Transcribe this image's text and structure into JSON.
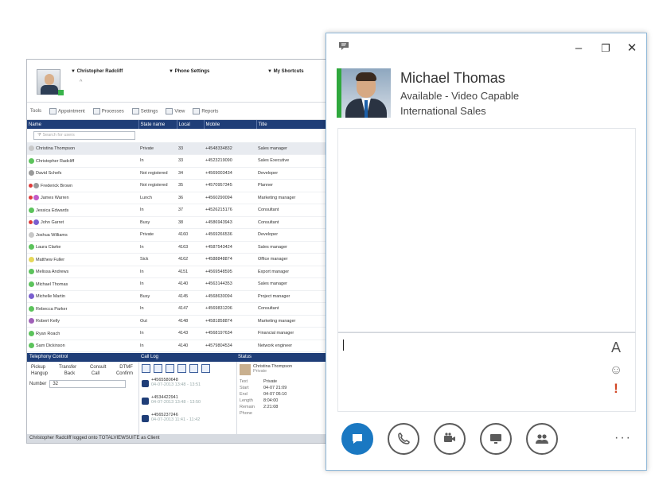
{
  "bg_window": {
    "user_menu": "Christopher Radcliff",
    "phone_menu": "Phone Settings",
    "shortcuts_menu": "My Shortcuts",
    "toolbar": [
      "Tools",
      "Appointment",
      "Processes",
      "Settings",
      "View",
      "Reports"
    ],
    "columns": [
      "Name",
      "State name",
      "Local",
      "Mobile",
      "Title"
    ],
    "search_placeholder": "Search for users",
    "contacts": [
      {
        "name": "Christina Thompson",
        "state": "Private",
        "local": "33",
        "mobile": "+4548334832",
        "title": "Sales manager",
        "dot": "#c8c8c8",
        "cc": false
      },
      {
        "name": "Christopher Radcliff",
        "state": "In",
        "local": "33",
        "mobile": "+4523219090",
        "title": "Sales Executive",
        "dot": "#5cc35c",
        "cc": false
      },
      {
        "name": "David Schefs",
        "state": "Not registered",
        "local": "34",
        "mobile": "+4569003434",
        "title": "Developer",
        "dot": "#9a9a9a",
        "cc": false
      },
      {
        "name": "Frederick Brown",
        "state": "Not registered",
        "local": "35",
        "mobile": "+4570957345",
        "title": "Planner",
        "dot": "#9a9a9a",
        "cc": true
      },
      {
        "name": "James Warren",
        "state": "Lunch",
        "local": "36",
        "mobile": "+4560290094",
        "title": "Marketing manager",
        "dot": "#c15cc8",
        "cc": true
      },
      {
        "name": "Jessica Edwards",
        "state": "In",
        "local": "37",
        "mobile": "+4526215176",
        "title": "Consultant",
        "dot": "#5cc35c",
        "cc": false
      },
      {
        "name": "John Garret",
        "state": "Busy",
        "local": "38",
        "mobile": "+4586943943",
        "title": "Consultant",
        "dot": "#7a5fcf",
        "cc": true
      },
      {
        "name": "Joshua Williams",
        "state": "Private",
        "local": "4160",
        "mobile": "+4569266536",
        "title": "Developer",
        "dot": "#c8c8c8",
        "cc": false
      },
      {
        "name": "Laura Clarke",
        "state": "In",
        "local": "4163",
        "mobile": "+4587543424",
        "title": "Sales manager",
        "dot": "#5cc35c",
        "cc": false
      },
      {
        "name": "Matthew Fuller",
        "state": "Sick",
        "local": "4162",
        "mobile": "+4588848874",
        "title": "Office manager",
        "dot": "#e6d85a",
        "cc": false
      },
      {
        "name": "Melissa Andrews",
        "state": "In",
        "local": "4151",
        "mobile": "+4569548595",
        "title": "Export manager",
        "dot": "#5cc35c",
        "cc": false
      },
      {
        "name": "Michael Thomas",
        "state": "In",
        "local": "4140",
        "mobile": "+4563144353",
        "title": "Sales manager",
        "dot": "#5cc35c",
        "cc": false
      },
      {
        "name": "Michelle Martin",
        "state": "Busy",
        "local": "4145",
        "mobile": "+4568630094",
        "title": "Project manager",
        "dot": "#7a5fcf",
        "cc": false
      },
      {
        "name": "Rebecca Parker",
        "state": "In",
        "local": "4147",
        "mobile": "+4569831206",
        "title": "Consultant",
        "dot": "#5cc35c",
        "cc": false
      },
      {
        "name": "Robert Kelly",
        "state": "Out",
        "local": "4148",
        "mobile": "+4581858874",
        "title": "Marketing manager",
        "dot": "#a060b8",
        "cc": false
      },
      {
        "name": "Ryan Roach",
        "state": "In",
        "local": "4143",
        "mobile": "+4568197634",
        "title": "Financial manager",
        "dot": "#5cc35c",
        "cc": false
      },
      {
        "name": "Sam Dickinson",
        "state": "In",
        "local": "4140",
        "mobile": "+4579804534",
        "title": "Network engineer",
        "dot": "#5cc35c",
        "cc": false
      }
    ],
    "panel_titles": [
      "Telephony Control",
      "Call Log",
      "Status"
    ],
    "telephony": {
      "row1": [
        "Pickup",
        "Transfer",
        "Consult",
        "DTMF"
      ],
      "row2": [
        "Hangup",
        "Back",
        "Call",
        "Confirm"
      ],
      "number_label": "Number",
      "number_value": "32"
    },
    "calllog": [
      {
        "num": "+4565580648",
        "time": "04-07-2013 13:48 - 13:51"
      },
      {
        "num": "+4534422941",
        "time": "04-07-2013 13:48 - 13:50"
      },
      {
        "num": "+4565237246",
        "time": "04-07-2013 11:41 - 11:42"
      }
    ],
    "detail": {
      "name": "Christina Thompson",
      "status": "Private",
      "rows": [
        [
          "Text",
          "Private"
        ],
        [
          "Start",
          "04-07 21:09"
        ],
        [
          "End",
          "04-07 05:10"
        ],
        [
          "Length",
          "8:04:00"
        ],
        [
          "Remain",
          "2:21:08"
        ],
        [
          "Phone",
          ""
        ]
      ]
    },
    "statusbar": "Christopher Radcliff logged onto TOTALVIEWSUITE as Client"
  },
  "conv": {
    "contact_name": "Michael Thomas",
    "contact_status": "Available - Video Capable",
    "contact_dept": "International Sales",
    "presence_color": "#2fa83d",
    "accent_color": "#1a78c2",
    "icons": {
      "app": "chat-bubble-icon",
      "minimize": "minimize-icon",
      "maximize": "maximize-icon",
      "close": "close-icon",
      "font": "font-icon",
      "emoticon": "emoticon-icon",
      "importance": "importance-icon",
      "more": "more-options-icon"
    },
    "window_glyphs": {
      "minimize": "–",
      "maximize": "❐",
      "close": "✕"
    },
    "compose_glyphs": {
      "font": "A",
      "emoticon": "☺",
      "importance": "!",
      "more": "···"
    }
  }
}
